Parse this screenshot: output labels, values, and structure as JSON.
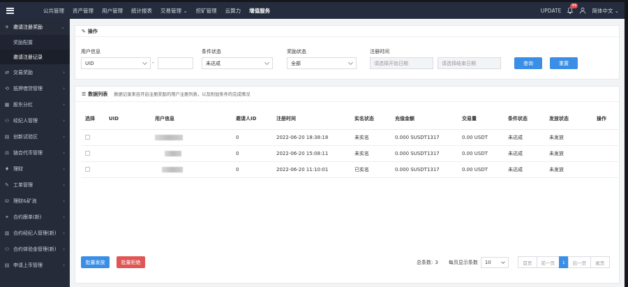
{
  "topbar": {
    "brand": "",
    "nav": [
      "公共管理",
      "资产管理",
      "用户管理",
      "统计报表",
      "交易管理 ⌄",
      "挖矿管理",
      "云算力",
      "增值服务"
    ],
    "active_index": 7,
    "update_label": "UPDATE",
    "notif_count": "99",
    "language": "简体中文 ⌄"
  },
  "sidebar": {
    "open_item": "邀请注册奖励",
    "sub_items": [
      "奖励配置",
      "邀请注册记录"
    ],
    "active_sub_index": 1,
    "items": [
      {
        "icon": "⇄",
        "label": "交易奖励"
      },
      {
        "icon": "⟲",
        "label": "抵押借贷管理"
      },
      {
        "icon": "▦",
        "label": "股东分红"
      },
      {
        "icon": "⚇",
        "label": "经纪人管理"
      },
      {
        "icon": "▤",
        "label": "创新试验区"
      },
      {
        "icon": "⚖",
        "label": "链合代币管理"
      },
      {
        "icon": "♦",
        "label": "理财"
      },
      {
        "icon": "✎",
        "label": "工单管理"
      },
      {
        "icon": "⛁",
        "label": "理财&矿池"
      },
      {
        "icon": "⚭",
        "label": "合约跟单(新)"
      },
      {
        "icon": "▥",
        "label": "合约经纪人管理(新)"
      },
      {
        "icon": "⚇",
        "label": "合约体验金管理(新)"
      },
      {
        "icon": "▤",
        "label": "申请上币管理"
      }
    ]
  },
  "filter": {
    "title": "操作",
    "user_info_label": "用户信息",
    "uid_select": "UID",
    "uid_input": "",
    "dash": "-",
    "condition_label": "条件状态",
    "condition_value": "未达成",
    "reward_label": "奖励状态",
    "reward_value": "全部",
    "reg_time_label": "注册时间",
    "start_placeholder": "请选择开始日期",
    "end_placeholder": "请选择结束日期",
    "query_button": "查询",
    "reset_button": "重置"
  },
  "list": {
    "title": "数据列表",
    "desc": "数据记录来自开启注册奖励的用户注册列表，以及附加条件的完成情况",
    "columns": [
      "选择",
      "UID",
      "用户信息",
      "邀请人ID",
      "注册时间",
      "实名状态",
      "充值金额",
      "交易量",
      "条件状态",
      "发放状态",
      "操作"
    ],
    "rows": [
      {
        "inviter": "0",
        "reg_time": "2022-06-20 18:38:18",
        "kyc": "未实名",
        "deposit": "0.000 SUSDT1317",
        "volume": "0.00 USDT",
        "condition": "未达成",
        "payout": "未发放"
      },
      {
        "inviter": "0",
        "reg_time": "2022-06-20 15:08:11",
        "kyc": "未实名",
        "deposit": "0.000 SUSDT1317",
        "volume": "0.00 USDT",
        "condition": "未达成",
        "payout": "未发放"
      },
      {
        "inviter": "0",
        "reg_time": "2022-06-20 11:10:01",
        "kyc": "已实名",
        "deposit": "0.000 SUSDT1317",
        "volume": "0.00 USDT",
        "condition": "未达成",
        "payout": "未发放"
      }
    ],
    "batch_pay": "批量发放",
    "batch_reject": "批量拒绝"
  },
  "pager": {
    "total_label": "总条数:",
    "total": "3",
    "per_page_label": "每页显示条数",
    "per_page": "10",
    "first": "首页",
    "prev": "前一页",
    "current": "1",
    "next": "后一页",
    "last": "尾页"
  }
}
